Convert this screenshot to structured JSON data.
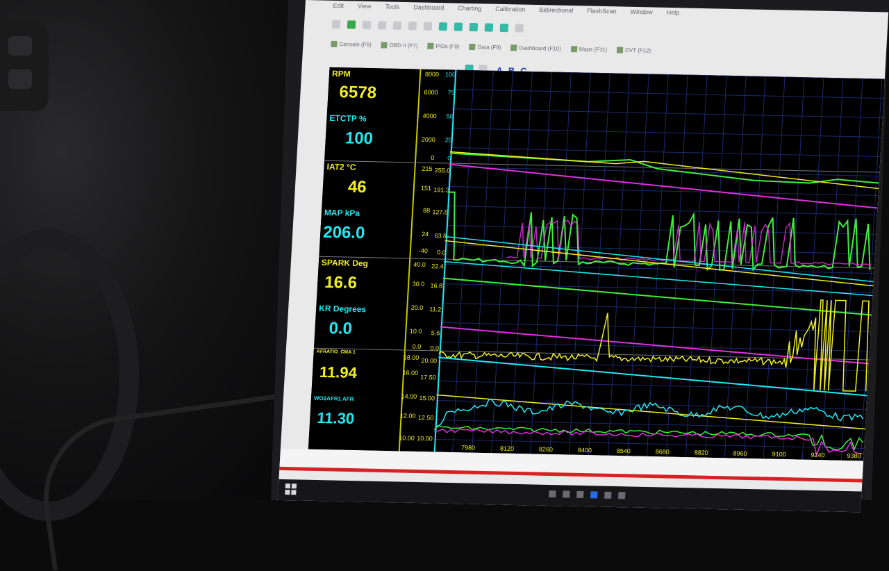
{
  "menu": [
    "Edit",
    "View",
    "Tools",
    "Dashboard",
    "Charting",
    "Calibration",
    "Bidirectional",
    "FlashScan",
    "Window",
    "Help"
  ],
  "tabs": [
    {
      "label": "Console (F6)"
    },
    {
      "label": "OBD II (F7)"
    },
    {
      "label": "PIDs (F8)"
    },
    {
      "label": "Data (F9)"
    },
    {
      "label": "Dashboard (F10)"
    },
    {
      "label": "Maps (F11)"
    },
    {
      "label": "DVT (F12)"
    }
  ],
  "abc": [
    "A",
    "B",
    "C"
  ],
  "readouts": {
    "rpm": {
      "label": "RPM",
      "value": "6578"
    },
    "etctp": {
      "label": "ETCTP %",
      "value": "100"
    },
    "iat2": {
      "label": "IAT2 °C",
      "value": "46"
    },
    "map": {
      "label": "MAP kPa",
      "value": "206.0"
    },
    "spark": {
      "label": "SPARK Deg",
      "value": "16.6"
    },
    "kr": {
      "label": "KR Degrees",
      "value": "0.0"
    },
    "afr_cmd": {
      "label": "AFRATIO_CMA 1",
      "value": "11.94"
    },
    "wo2": {
      "label": "WO2AFR1 AFR",
      "value": "11.30"
    }
  },
  "axes": {
    "rpm_ticks": [
      "8000",
      "6000",
      "4000",
      "2000",
      "0"
    ],
    "etc_ticks": [
      "100",
      "75",
      "50",
      "25",
      "0"
    ],
    "iat_ticks": [
      "215",
      "151",
      "88",
      "24",
      "-40"
    ],
    "map_ticks": [
      "255.0",
      "191.3",
      "127.5",
      "63.8",
      "0.0"
    ],
    "spark_ticks": [
      "40.0",
      "30.0",
      "20.0",
      "10.0",
      "0.0"
    ],
    "kr_ticks": [
      "22.4",
      "16.8",
      "11.2",
      "5.6",
      "0.0"
    ],
    "afr_ticks": [
      "18.00",
      "16.00",
      "14.00",
      "12.00",
      "10.00"
    ],
    "wo2_ticks": [
      "20.00",
      "17.50",
      "15.00",
      "12.50",
      "10.00"
    ],
    "x_ticks": [
      "7980",
      "8120",
      "8260",
      "8400",
      "8540",
      "8680",
      "8820",
      "8960",
      "9100",
      "9240",
      "9380"
    ]
  },
  "colors": {
    "yellow": "#f2ee22",
    "cyan": "#22e8f2",
    "magenta": "#e22ee2",
    "green": "#3ef03a",
    "grid": "#1a2a6a"
  }
}
